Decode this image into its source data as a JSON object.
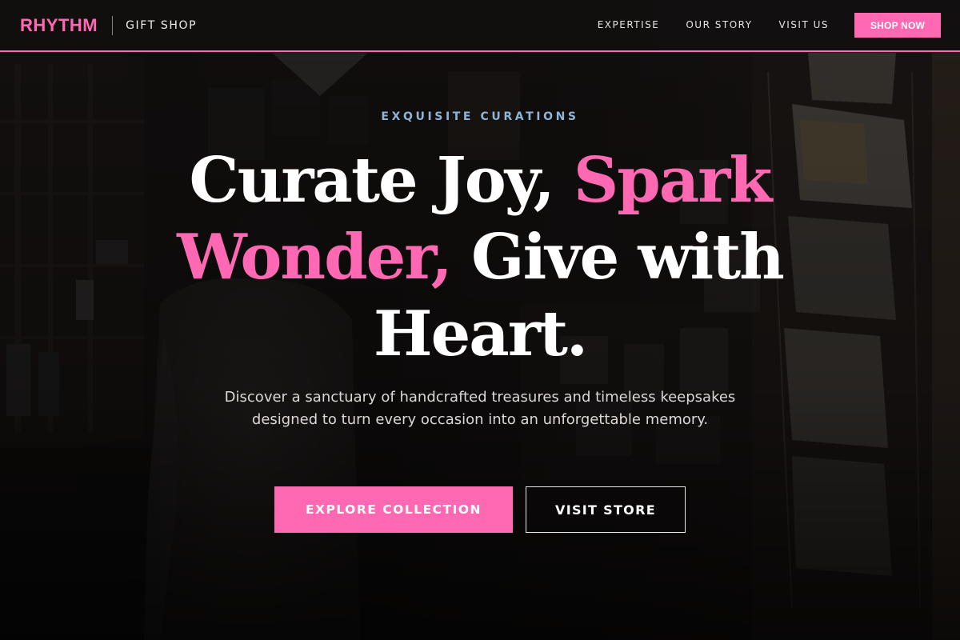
{
  "brand": {
    "name": "RHYTHM",
    "sub": "GIFT SHOP"
  },
  "nav": {
    "links": [
      {
        "label": "EXPERTISE"
      },
      {
        "label": "OUR STORY"
      },
      {
        "label": "VISIT US"
      }
    ],
    "cta_label": "SHOP NOW"
  },
  "hero": {
    "eyebrow": "EXQUISITE CURATIONS",
    "headline": {
      "part1": "Curate Joy, ",
      "accent1": "Spark Wonder,",
      "part2": " Give with Heart."
    },
    "lede": "Discover a sanctuary of handcrafted treasures and timeless keepsakes designed to turn every occasion into an unforgettable memory.",
    "primary_cta": "EXPLORE COLLECTION",
    "secondary_cta": "VISIT STORE"
  },
  "colors": {
    "accent": "#ff69b4",
    "eyebrow": "#8fb4d6",
    "header_bg": "#110f0f",
    "page_bg": "#120f10"
  }
}
